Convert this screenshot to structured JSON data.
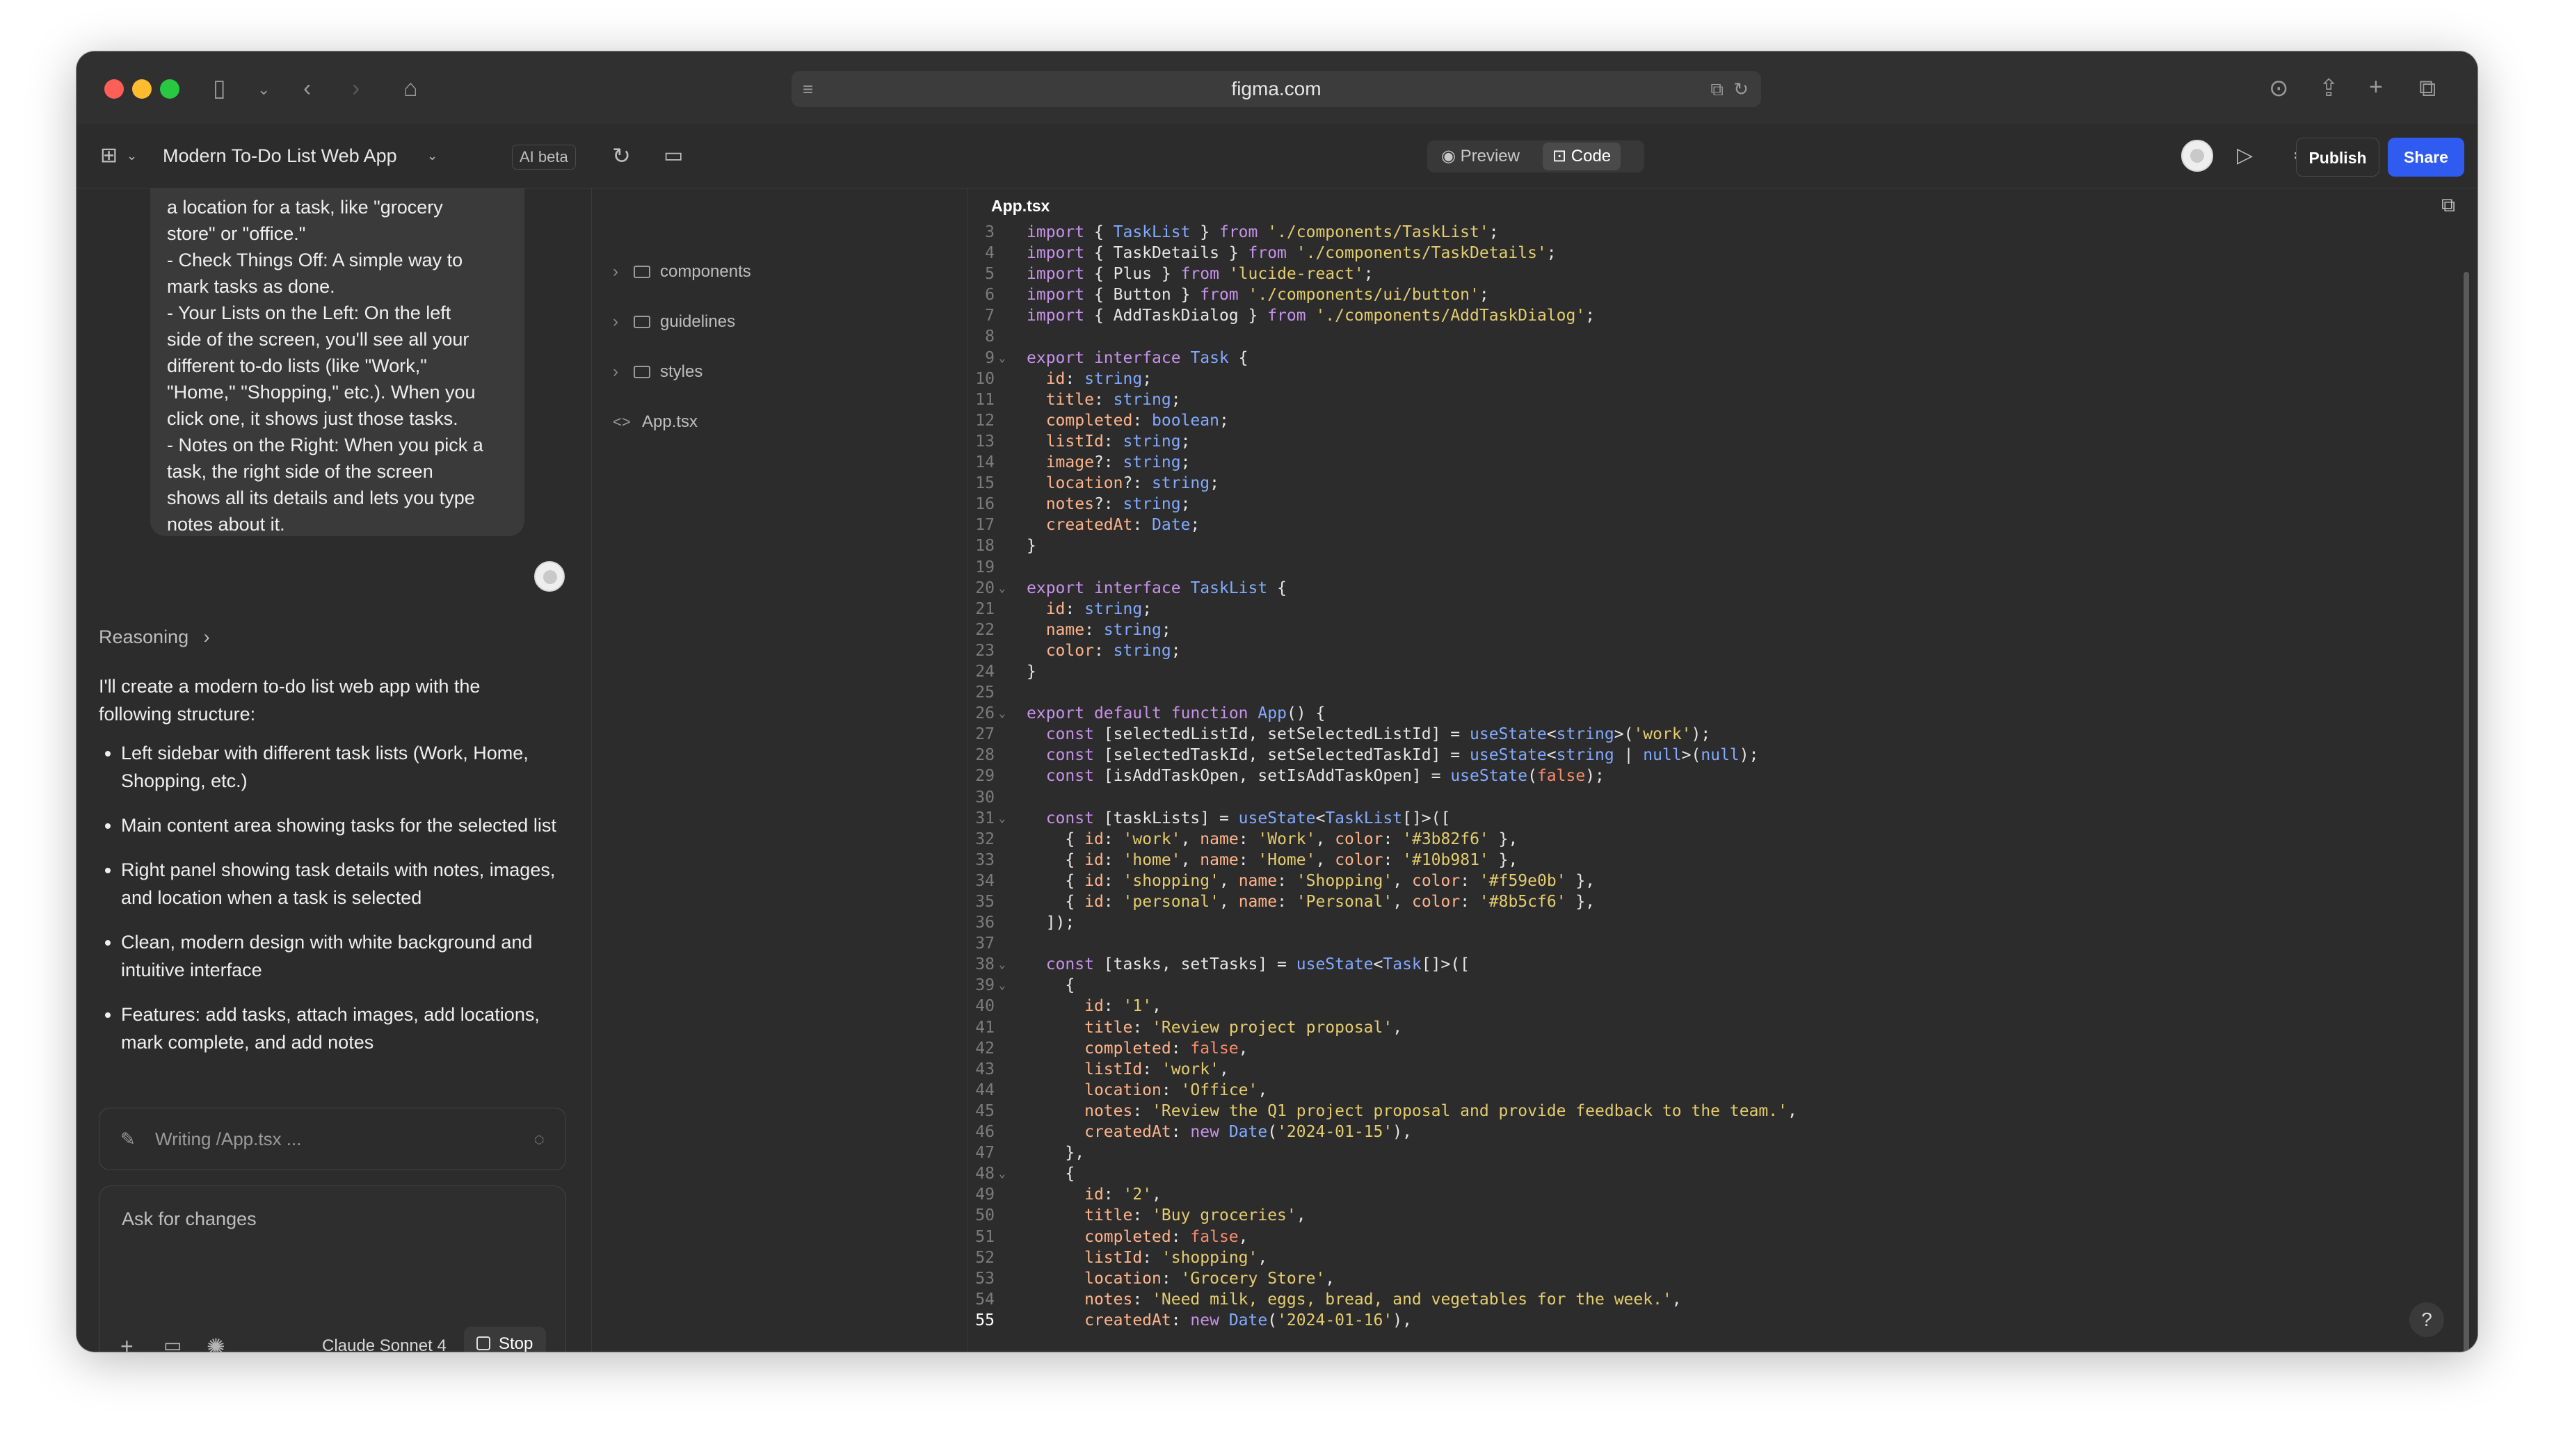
{
  "browser": {
    "url": "figma.com"
  },
  "header": {
    "project_title": "Modern To-Do List Web App",
    "ai_badge": "AI beta",
    "preview_label": "Preview",
    "code_label": "Code",
    "publish_label": "Publish",
    "share_label": "Share"
  },
  "chat": {
    "bubble_lines": [
      "a location for a task, like \"grocery",
      "store\" or \"office.\"",
      "- Check Things Off: A simple way to",
      "mark tasks as done.",
      "- Your Lists on the Left: On the left",
      "side of the screen, you'll see all your",
      "different to-do lists (like \"Work,\"",
      "\"Home,\" \"Shopping,\" etc.). When you",
      "click one, it shows just those tasks.",
      "- Notes on the Right: When you pick a",
      "task, the right side of the screen",
      "shows all its details and lets you type",
      "notes about it."
    ],
    "reasoning_label": "Reasoning",
    "intro": "I'll create a modern to-do list web app with the following structure:",
    "bullets": [
      "Left sidebar with different task lists (Work, Home, Shopping, etc.)",
      "Main content area showing tasks for the selected list",
      "Right panel showing task details with notes, images, and location when a task is selected",
      "Clean, modern design with white background and intuitive interface",
      "Features: add tasks, attach images, add locations, mark complete, and add notes"
    ],
    "writing_status": "Writing /App.tsx ...",
    "input_placeholder": "Ask for changes",
    "model_name": "Claude Sonnet 4",
    "stop_label": "Stop"
  },
  "file_tree": {
    "items": [
      {
        "name": "components",
        "type": "folder"
      },
      {
        "name": "guidelines",
        "type": "folder"
      },
      {
        "name": "styles",
        "type": "folder"
      },
      {
        "name": "App.tsx",
        "type": "file"
      }
    ]
  },
  "editor": {
    "tab_label": "App.tsx",
    "lines": [
      {
        "n": "3",
        "code": "import { TaskList } from './components/TaskList';"
      },
      {
        "n": "4",
        "code": "import { TaskDetails } from './components/TaskDetails';"
      },
      {
        "n": "5",
        "code": "import { Plus } from 'lucide-react';"
      },
      {
        "n": "6",
        "code": "import { Button } from './components/ui/button';"
      },
      {
        "n": "7",
        "code": "import { AddTaskDialog } from './components/AddTaskDialog';"
      },
      {
        "n": "8",
        "code": ""
      },
      {
        "n": "9",
        "code": "export interface Task {",
        "fold": true
      },
      {
        "n": "10",
        "code": "  id: string;"
      },
      {
        "n": "11",
        "code": "  title: string;"
      },
      {
        "n": "12",
        "code": "  completed: boolean;"
      },
      {
        "n": "13",
        "code": "  listId: string;"
      },
      {
        "n": "14",
        "code": "  image?: string;"
      },
      {
        "n": "15",
        "code": "  location?: string;"
      },
      {
        "n": "16",
        "code": "  notes?: string;"
      },
      {
        "n": "17",
        "code": "  createdAt: Date;"
      },
      {
        "n": "18",
        "code": "}"
      },
      {
        "n": "19",
        "code": ""
      },
      {
        "n": "20",
        "code": "export interface TaskList {",
        "fold": true
      },
      {
        "n": "21",
        "code": "  id: string;"
      },
      {
        "n": "22",
        "code": "  name: string;"
      },
      {
        "n": "23",
        "code": "  color: string;"
      },
      {
        "n": "24",
        "code": "}"
      },
      {
        "n": "25",
        "code": ""
      },
      {
        "n": "26",
        "code": "export default function App() {",
        "fold": true
      },
      {
        "n": "27",
        "code": "  const [selectedListId, setSelectedListId] = useState<string>('work');"
      },
      {
        "n": "28",
        "code": "  const [selectedTaskId, setSelectedTaskId] = useState<string | null>(null);"
      },
      {
        "n": "29",
        "code": "  const [isAddTaskOpen, setIsAddTaskOpen] = useState(false);"
      },
      {
        "n": "30",
        "code": ""
      },
      {
        "n": "31",
        "code": "  const [taskLists] = useState<TaskList[]>([",
        "fold": true
      },
      {
        "n": "32",
        "code": "    { id: 'work', name: 'Work', color: '#3b82f6' },"
      },
      {
        "n": "33",
        "code": "    { id: 'home', name: 'Home', color: '#10b981' },"
      },
      {
        "n": "34",
        "code": "    { id: 'shopping', name: 'Shopping', color: '#f59e0b' },"
      },
      {
        "n": "35",
        "code": "    { id: 'personal', name: 'Personal', color: '#8b5cf6' },"
      },
      {
        "n": "36",
        "code": "  ]);"
      },
      {
        "n": "37",
        "code": ""
      },
      {
        "n": "38",
        "code": "  const [tasks, setTasks] = useState<Task[]>([",
        "fold": true
      },
      {
        "n": "39",
        "code": "    {",
        "fold": true
      },
      {
        "n": "40",
        "code": "      id: '1',"
      },
      {
        "n": "41",
        "code": "      title: 'Review project proposal',"
      },
      {
        "n": "42",
        "code": "      completed: false,"
      },
      {
        "n": "43",
        "code": "      listId: 'work',"
      },
      {
        "n": "44",
        "code": "      location: 'Office',"
      },
      {
        "n": "45",
        "code": "      notes: 'Review the Q1 project proposal and provide feedback to the team.',"
      },
      {
        "n": "46",
        "code": "      createdAt: new Date('2024-01-15'),"
      },
      {
        "n": "47",
        "code": "    },"
      },
      {
        "n": "48",
        "code": "    {",
        "fold": true
      },
      {
        "n": "49",
        "code": "      id: '2',"
      },
      {
        "n": "50",
        "code": "      title: 'Buy groceries',"
      },
      {
        "n": "51",
        "code": "      completed: false,"
      },
      {
        "n": "52",
        "code": "      listId: 'shopping',"
      },
      {
        "n": "53",
        "code": "      location: 'Grocery Store',"
      },
      {
        "n": "54",
        "code": "      notes: 'Need milk, eggs, bread, and vegetables for the week.',"
      },
      {
        "n": "55",
        "code": "      createdAt: new Date('2024-01-16'),",
        "active": true
      }
    ]
  },
  "colors": {
    "window_bg": "#2c2c2c",
    "share_button": "#2f5bf0",
    "traffic_red": "#ff5f57",
    "traffic_yellow": "#febc2e",
    "traffic_green": "#28c840"
  }
}
